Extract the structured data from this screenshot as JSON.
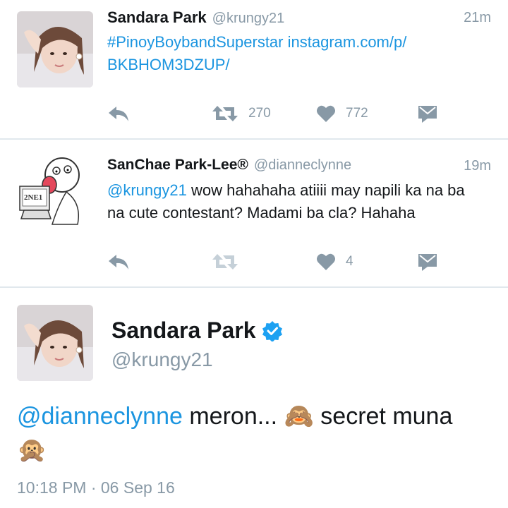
{
  "tweets": [
    {
      "name": "Sandara Park",
      "handle": "@krungy21",
      "time": "21m",
      "text_link": "#PinoyBoybandSuperstar instagram.com/p/",
      "text_link2": "BKBHOM3DZUP/",
      "retweets": "270",
      "likes": "772"
    },
    {
      "name": "SanChae Park-Lee®",
      "handle": "@dianneclynne",
      "time": "19m",
      "mention": "@krungy21",
      "text": " wow hahahaha atiiii may napili ka na ba",
      "text2": "na cute contestant? Madami ba cla? Hahaha",
      "retweets": "",
      "likes": "4",
      "avatar_label": "2NE1"
    }
  ],
  "focused": {
    "name": "Sandara Park",
    "handle": "@krungy21",
    "mention": "@dianneclynne",
    "text": " meron... 🙈 secret muna",
    "text2": "🙊",
    "timestamp": "10:18 PM · 06 Sep 16"
  },
  "colors": {
    "link": "#1b95e0",
    "muted": "#8899a6",
    "verified": "#1da1f2",
    "divider": "#e1e8ed"
  },
  "icons": [
    "reply-icon",
    "retweet-icon",
    "like-icon",
    "direct-message-icon",
    "verified-badge-icon"
  ]
}
